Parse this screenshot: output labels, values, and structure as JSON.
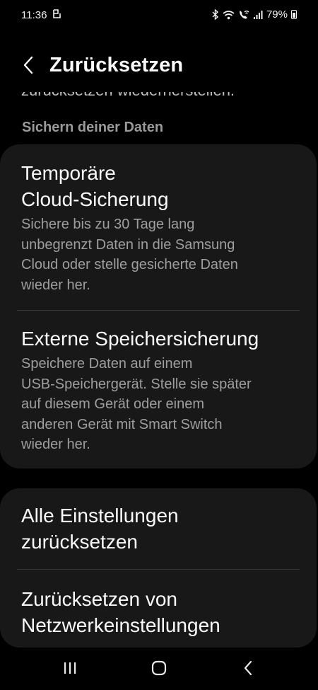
{
  "status_bar": {
    "time": "11:36",
    "battery_percent": "79%",
    "icons": [
      "notification-app-icon",
      "bluetooth-icon",
      "wifi-icon",
      "wifi-calling-icon",
      "signal-icon",
      "battery-icon"
    ]
  },
  "header": {
    "title": "Zurücksetzen",
    "back_icon": "chevron-left-icon"
  },
  "cut_off_text": "zurücksetzen wiederherstellen.",
  "section": {
    "title": "Sichern deiner Daten"
  },
  "backup_items": [
    {
      "title_line1": "Temporäre",
      "title_line2": "Cloud-Sicherung",
      "desc_lines": [
        "Sichere bis zu 30 Tage lang",
        "unbegrenzt Daten in die Samsung",
        "Cloud oder stelle gesicherte Daten",
        "wieder her."
      ]
    },
    {
      "title_line1": "Externe Speichersicherung",
      "desc_lines": [
        "Speichere Daten auf einem",
        "USB-Speichergerät. Stelle sie später",
        "auf diesem Gerät oder einem",
        "anderen Gerät mit Smart Switch",
        "wieder her."
      ]
    }
  ],
  "reset_items": [
    {
      "title_line1": "Alle Einstellungen",
      "title_line2": "zurücksetzen"
    },
    {
      "title_line1": "Zurücksetzen von",
      "title_line2": "Netzwerkeinstellungen"
    }
  ],
  "nav_bar": {
    "icons": [
      "recent-apps-icon",
      "home-icon",
      "back-icon"
    ]
  },
  "colors": {
    "background": "#000000",
    "card": "#181818",
    "primary_text": "#fafafa",
    "secondary_text": "#9e9e9e",
    "section_header": "#9a9a9a"
  }
}
